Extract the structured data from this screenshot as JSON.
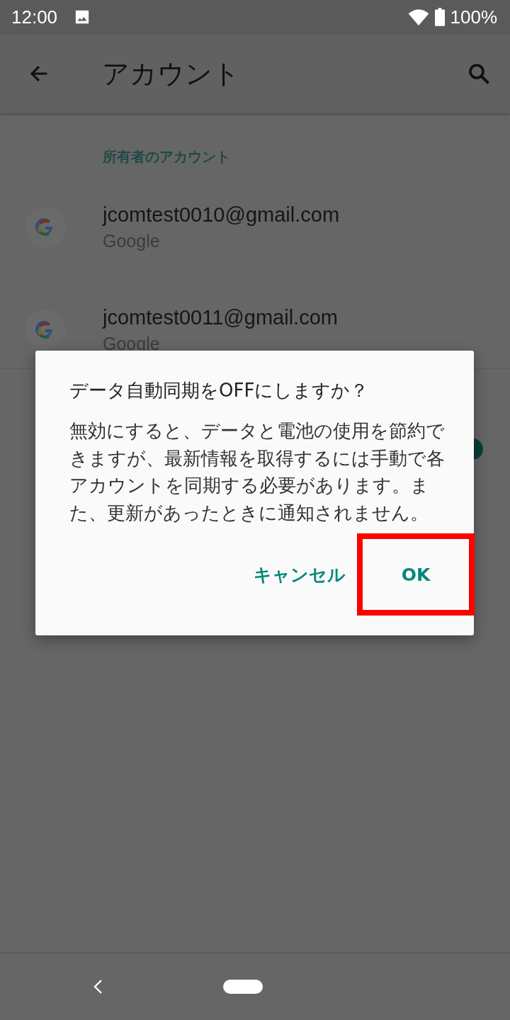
{
  "status_bar": {
    "time": "12:00",
    "battery": "100%"
  },
  "app_bar": {
    "title": "アカウント"
  },
  "section": {
    "header": "所有者のアカウント"
  },
  "accounts": [
    {
      "email": "jcomtest0010@gmail.com",
      "provider": "Google"
    },
    {
      "email": "jcomtest0011@gmail.com",
      "provider": "Google"
    }
  ],
  "sync_switch": {
    "on": true
  },
  "dialog": {
    "title": "データ自動同期をOFFにしますか？",
    "message": "無効にすると、データと電池の使用を節約できますが、最新情報を取得するには手動で各アカウントを同期する必要があります。また、更新があったときに通知されません。",
    "buttons": [
      {
        "label": "キャンセル",
        "highlighted": false
      },
      {
        "label": "OK",
        "highlighted": true
      }
    ]
  }
}
